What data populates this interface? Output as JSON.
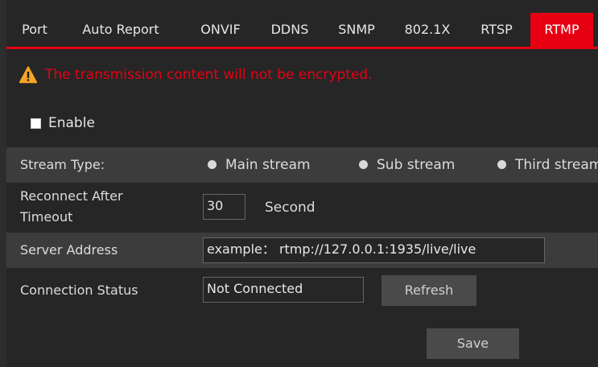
{
  "tabs": [
    {
      "label": "Port"
    },
    {
      "label": "Auto Report"
    },
    {
      "label": "ONVIF"
    },
    {
      "label": "DDNS"
    },
    {
      "label": "SNMP"
    },
    {
      "label": "802.1X"
    },
    {
      "label": "RTSP"
    },
    {
      "label": "RTMP",
      "active": true
    }
  ],
  "warning": {
    "icon": "warning-triangle-icon",
    "text": "The transmission content will not be encrypted."
  },
  "enable": {
    "label": "Enable",
    "checked": false
  },
  "stream_type": {
    "label": "Stream Type:",
    "options": [
      "Main stream",
      "Sub stream",
      "Third stream"
    ],
    "selected": null
  },
  "reconnect": {
    "label_line1": "Reconnect After",
    "label_line2": "Timeout",
    "value": "30",
    "unit": "Second"
  },
  "server_address": {
    "label": "Server Address",
    "value": "example： rtmp://127.0.0.1:1935/live/live"
  },
  "connection_status": {
    "label": "Connection Status",
    "value": "Not Connected",
    "refresh_label": "Refresh"
  },
  "save_label": "Save",
  "colors": {
    "accent": "#e60012",
    "background": "#262626",
    "row_shade": "#3c3c3c",
    "button": "#4a4a4a"
  }
}
